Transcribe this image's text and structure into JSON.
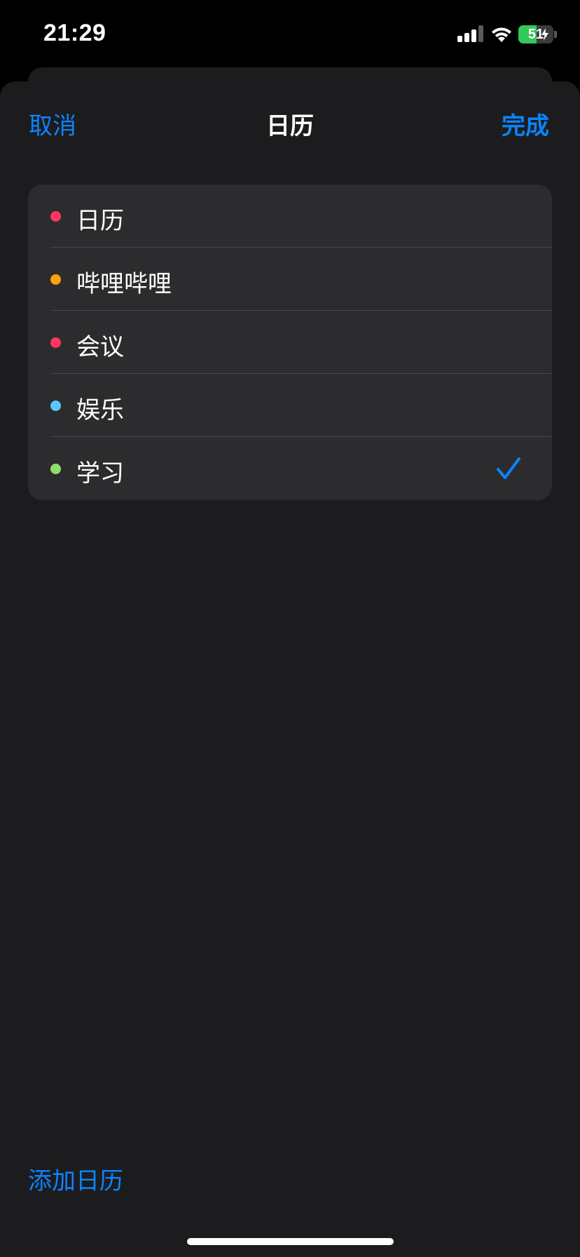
{
  "status_bar": {
    "time": "21:29",
    "battery_level": "51",
    "battery_fraction": 0.51,
    "signal_bars_active": 3,
    "icons": [
      "cellular-signal-icon",
      "wifi-icon",
      "battery-charging-icon"
    ]
  },
  "nav": {
    "cancel_label": "取消",
    "title": "日历",
    "done_label": "完成"
  },
  "calendars": [
    {
      "label": "日历",
      "color": "#ff375f",
      "selected": false
    },
    {
      "label": "哔哩哔哩",
      "color": "#ff9f0a",
      "selected": false
    },
    {
      "label": "会议",
      "color": "#ff375f",
      "selected": false
    },
    {
      "label": "娱乐",
      "color": "#5ac8fa",
      "selected": false
    },
    {
      "label": "学习",
      "color": "#8ee06a",
      "selected": true
    }
  ],
  "footer": {
    "add_calendar_label": "添加日历"
  },
  "colors": {
    "accent": "#0a84ff",
    "sheet_background": "#1c1c1e",
    "card_background": "#2c2c2e",
    "battery_green": "#34c759"
  }
}
